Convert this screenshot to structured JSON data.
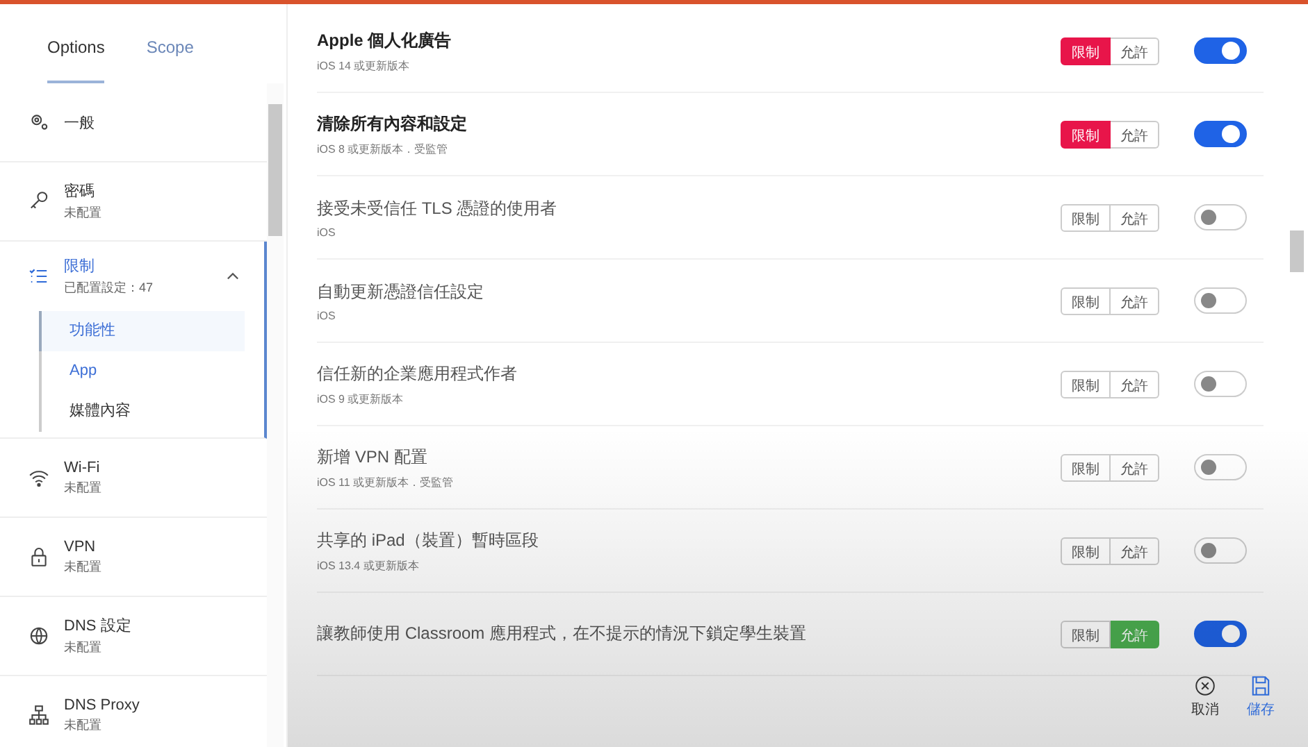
{
  "tabs": [
    {
      "label": "Options",
      "selected": true
    },
    {
      "label": "Scope",
      "selected": false
    }
  ],
  "sidebar": {
    "items": [
      {
        "label": "一般",
        "selected": false
      },
      {
        "label": "密碼",
        "status": "未配置",
        "selected": false
      },
      {
        "label": "限制",
        "status": "已配置設定：47",
        "selected": true,
        "expanded": true,
        "children": [
          {
            "label": "功能性",
            "selected": true
          },
          {
            "label": "App",
            "selected": false
          },
          {
            "label": "媒體內容",
            "selected": false
          }
        ]
      },
      {
        "label": "Wi-Fi",
        "status": "未配置",
        "selected": false
      },
      {
        "label": "VPN",
        "status": "未配置",
        "selected": false
      },
      {
        "label": "DNS 設定",
        "status": "未配置",
        "selected": false
      },
      {
        "label": "DNS Proxy",
        "status": "未配置",
        "selected": false
      }
    ]
  },
  "settings": [
    {
      "title": "Apple 個人化廣告",
      "note": "iOS 14 或更新版本",
      "options": [
        {
          "label": "限制",
          "selected": true
        },
        {
          "label": "允許",
          "selected": false
        }
      ],
      "on": true
    },
    {
      "title": "清除所有內容和設定",
      "note": "iOS 8 或更新版本．受監管",
      "options": [
        {
          "label": "限制",
          "selected": true
        },
        {
          "label": "允許",
          "selected": false
        }
      ],
      "on": true
    },
    {
      "title": "接受未受信任 TLS 憑證的使用者",
      "note": "iOS",
      "options": [
        {
          "label": "限制",
          "selected": false
        },
        {
          "label": "允許",
          "selected": false
        }
      ],
      "on": false
    },
    {
      "title": "自動更新憑證信任設定",
      "note": "iOS",
      "options": [
        {
          "label": "限制",
          "selected": false
        },
        {
          "label": "允許",
          "selected": false
        }
      ],
      "on": false
    },
    {
      "title": "信任新的企業應用程式作者",
      "note": "iOS 9 或更新版本",
      "options": [
        {
          "label": "限制",
          "selected": false
        },
        {
          "label": "允許",
          "selected": false
        }
      ],
      "on": false
    },
    {
      "title": "新增 VPN 配置",
      "note": "iOS 11 或更新版本．受監管",
      "options": [
        {
          "label": "限制",
          "selected": false
        },
        {
          "label": "允許",
          "selected": false
        }
      ],
      "on": false
    },
    {
      "title": "共享的 iPad（裝置）暫時區段",
      "note": "iOS 13.4 或更新版本",
      "options": [
        {
          "label": "限制",
          "selected": false
        },
        {
          "label": "允許",
          "selected": false
        }
      ],
      "on": false
    },
    {
      "title": "讓教師使用 Classroom 應用程式，在不提示的情況下鎖定學生裝置",
      "options": [
        {
          "label": "限制",
          "selected": false
        },
        {
          "label": "允許",
          "selected": true
        }
      ],
      "on": true
    }
  ],
  "footer": {
    "cancel": "取消",
    "save": "儲存"
  }
}
